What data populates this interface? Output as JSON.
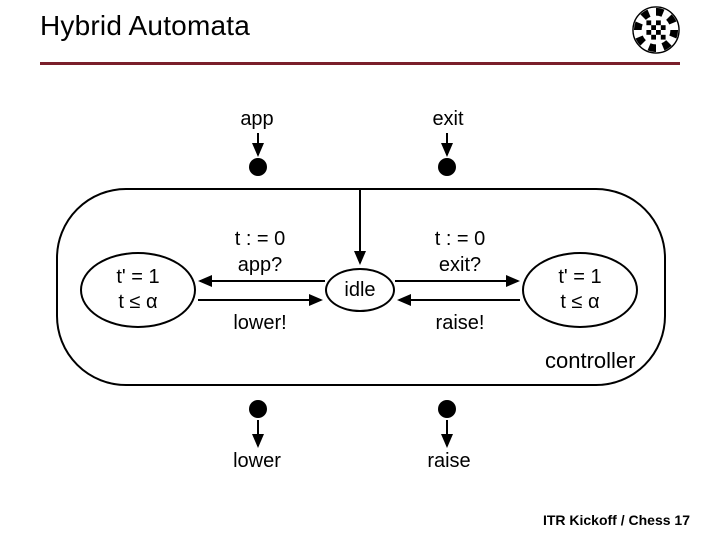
{
  "title": "Hybrid Automata",
  "top_inputs": {
    "app": "app",
    "exit": "exit"
  },
  "transitions": {
    "reset_left": "t : = 0",
    "guard_left": "app?",
    "action_left": "lower!",
    "reset_right": "t : = 0",
    "guard_right": "exit?",
    "action_right": "raise!"
  },
  "states": {
    "left_line1": "t' = 1",
    "left_line2": "t ≤ α",
    "center": "idle",
    "right_line1": "t' = 1",
    "right_line2": "t ≤ α"
  },
  "controller_label": "controller",
  "bottom_outputs": {
    "lower": "lower",
    "raise": "raise"
  },
  "footer": {
    "venue": "ITR Kickoff / Chess",
    "page": "17"
  }
}
